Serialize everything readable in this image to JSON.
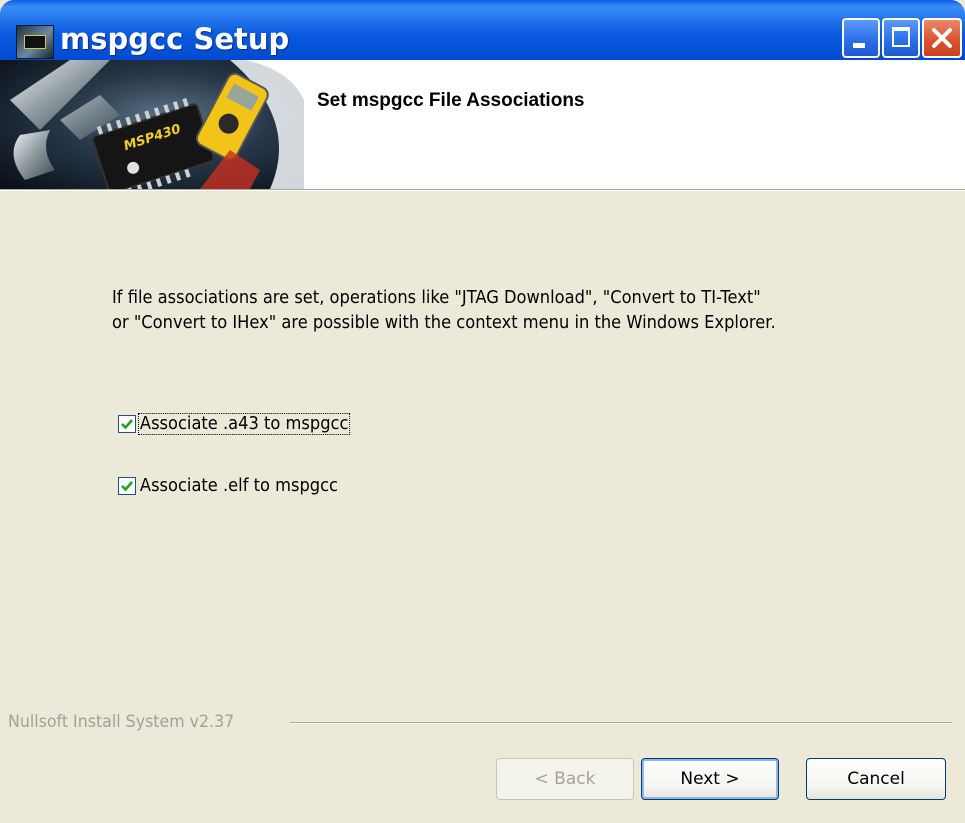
{
  "window": {
    "title": "mspgcc Setup",
    "app_icon": "mspgcc-setup-icon",
    "controls": [
      "minimize-icon",
      "maximize-icon",
      "close-icon"
    ]
  },
  "header": {
    "banner_image": "msp430-tools-banner",
    "banner_chip_label": "MSP430",
    "title": "Set mspgcc File Associations"
  },
  "content": {
    "description_lines": [
      "If file associations are set, operations like \"JTAG Download\", \"Convert to TI-Text\"",
      "or \"Convert to IHex\" are possible with the context menu in the Windows Explorer."
    ],
    "checkboxes": [
      {
        "label": "Associate .a43 to mspgcc",
        "checked": true,
        "focused": true
      },
      {
        "label": "Associate .elf to mspgcc",
        "checked": true,
        "focused": false
      }
    ]
  },
  "footer": {
    "branding": "Nullsoft Install System v2.37",
    "back_label": "< Back",
    "next_label": "Next >",
    "cancel_label": "Cancel",
    "back_enabled": false
  },
  "colors": {
    "title_bar": "#0a5ee8",
    "dialog_background": "#ece9d8",
    "header_background": "#ffffff",
    "check_mark": "#21a121",
    "close_button": "#dc5430"
  }
}
